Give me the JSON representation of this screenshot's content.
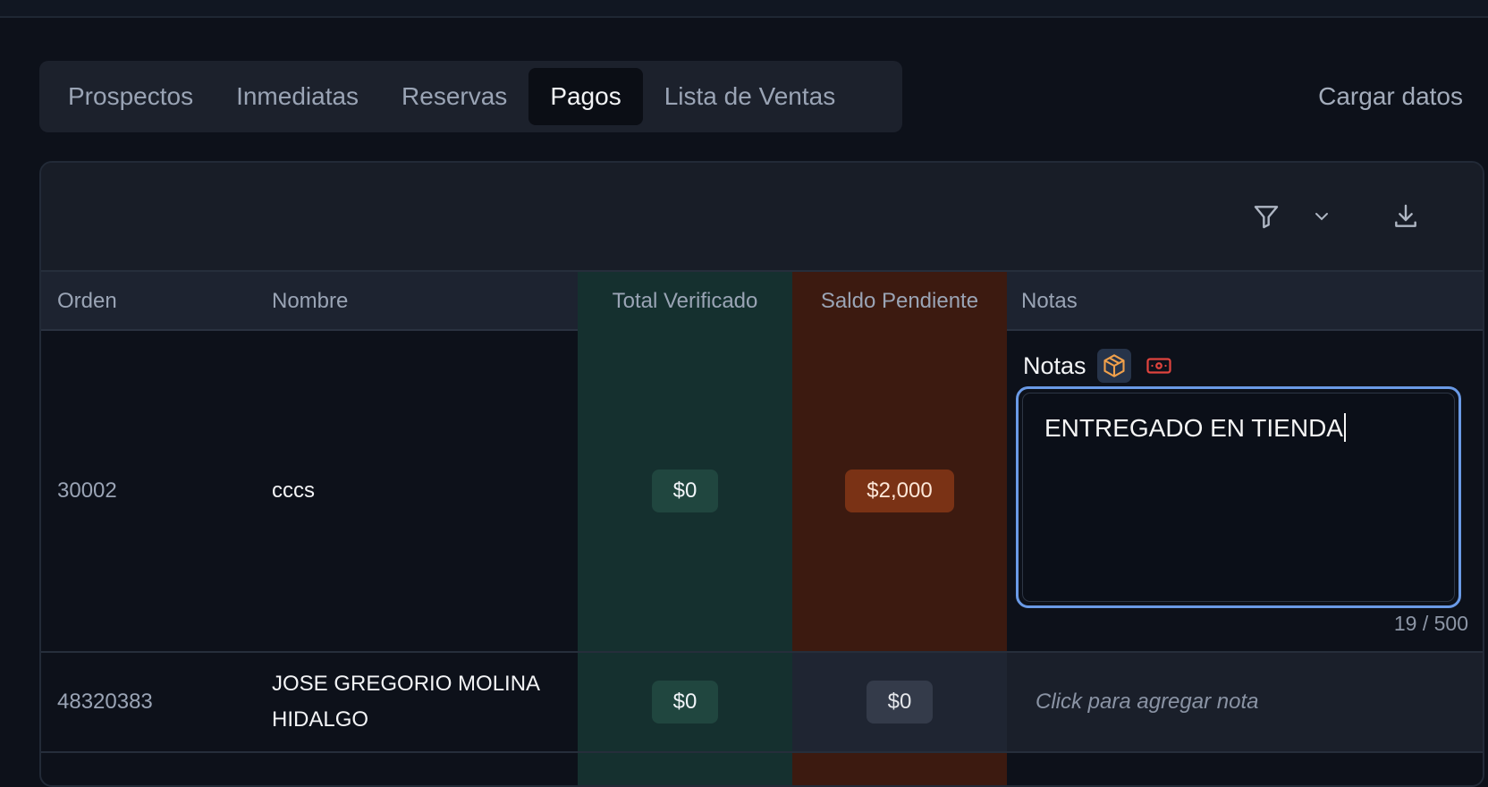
{
  "tabs": [
    {
      "label": "Prospectos"
    },
    {
      "label": "Inmediatas"
    },
    {
      "label": "Reservas"
    },
    {
      "label": "Pagos",
      "active": true
    },
    {
      "label": "Lista de Ventas"
    }
  ],
  "actions": {
    "load_data": "Cargar datos"
  },
  "toolbar": {
    "icons": [
      "filter-icon",
      "chevron-down-icon",
      "download-icon"
    ]
  },
  "table": {
    "columns": [
      "Orden",
      "Nombre",
      "Total Verificado",
      "Saldo Pendiente",
      "Notas"
    ],
    "rows": [
      {
        "orden": "30002",
        "nombre": "cccs",
        "total_verificado": "$0",
        "saldo_pendiente": "$2,000",
        "notes_editor": {
          "title": "Notas",
          "value": "ENTREGADO EN TIENDA",
          "counter": "19 / 500",
          "icons": [
            "package-icon",
            "cash-icon"
          ]
        }
      },
      {
        "orden": "48320383",
        "nombre": "JOSE GREGORIO MOLINA",
        "nombre_line2": "HIDALGO",
        "total_verificado": "$0",
        "saldo_pendiente": "$0",
        "note_placeholder": "Click para agregar nota"
      }
    ]
  },
  "colors": {
    "background": "#0d111a",
    "active_tab": "#0b0e15",
    "verified_column": "#15302f",
    "pending_column": "#3c1a10",
    "focus_ring": "#6a9ae6",
    "package_icon": "#f0a04b",
    "cash_icon": "#e0443e"
  }
}
